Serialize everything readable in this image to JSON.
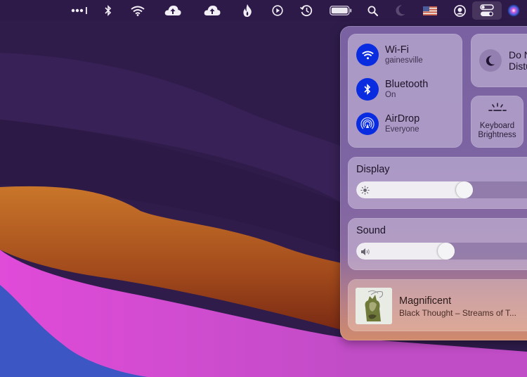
{
  "menubar": {
    "items": [
      {
        "name": "signal-dots-icon"
      },
      {
        "name": "bluetooth-icon"
      },
      {
        "name": "wifi-icon"
      },
      {
        "name": "cloud-upload-icon"
      },
      {
        "name": "cloud-upload-icon-2"
      },
      {
        "name": "flame-icon"
      },
      {
        "name": "play-circle-icon"
      },
      {
        "name": "time-machine-icon"
      },
      {
        "name": "battery-icon"
      },
      {
        "name": "spotlight-search-icon"
      },
      {
        "name": "moon-icon"
      },
      {
        "name": "us-flag-icon"
      },
      {
        "name": "user-account-icon"
      },
      {
        "name": "control-center-icon"
      },
      {
        "name": "siri-icon"
      }
    ]
  },
  "control_center": {
    "wifi": {
      "title": "Wi-Fi",
      "subtitle": "gainesville"
    },
    "bluetooth": {
      "title": "Bluetooth",
      "subtitle": "On"
    },
    "airdrop": {
      "title": "AirDrop",
      "subtitle": "Everyone"
    },
    "do_not_disturb": {
      "title": "Do Not\nDisturb"
    },
    "keyboard_brightness": {
      "title": "Keyboard\nBrightness"
    },
    "display": {
      "label": "Display",
      "level_percent": 53
    },
    "sound": {
      "label": "Sound",
      "level_percent": 44
    },
    "now_playing": {
      "title": "Magnificent",
      "subtitle": "Black Thought – Streams of T..."
    }
  },
  "colors": {
    "accent_blue": "#0a2ce0",
    "menubar_bg": "#2e1a48"
  }
}
